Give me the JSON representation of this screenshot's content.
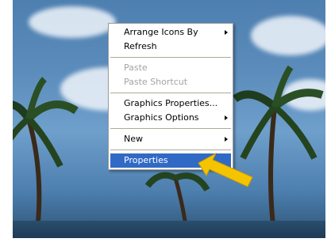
{
  "desktop": {
    "wallpaper": "palm-trees-beach"
  },
  "context_menu": {
    "items": [
      {
        "label": "Arrange Icons By",
        "has_submenu": true,
        "disabled": false
      },
      {
        "label": "Refresh",
        "has_submenu": false,
        "disabled": false
      },
      {
        "label": "Paste",
        "has_submenu": false,
        "disabled": true
      },
      {
        "label": "Paste Shortcut",
        "has_submenu": false,
        "disabled": true
      },
      {
        "label": "Graphics Properties...",
        "has_submenu": false,
        "disabled": false
      },
      {
        "label": "Graphics Options",
        "has_submenu": true,
        "disabled": false
      },
      {
        "label": "New",
        "has_submenu": true,
        "disabled": false
      },
      {
        "label": "Properties",
        "has_submenu": false,
        "disabled": false,
        "selected": true
      }
    ]
  },
  "annotation": {
    "icon": "yellow-arrow-icon",
    "color": "#f5c400"
  }
}
